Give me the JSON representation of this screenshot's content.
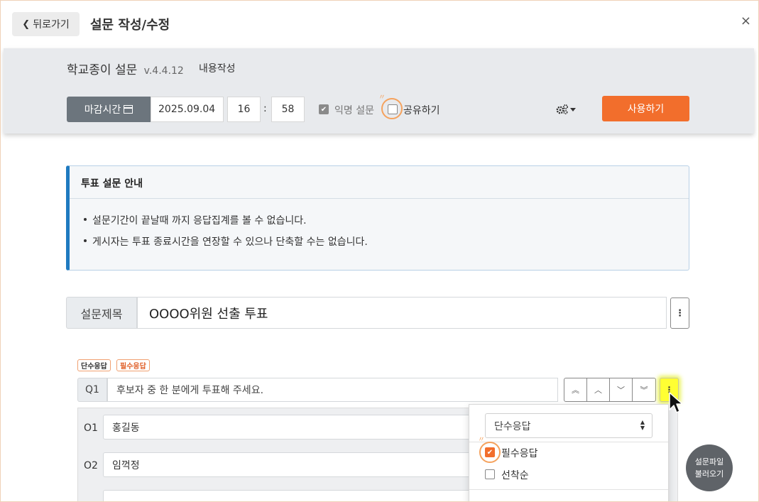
{
  "header": {
    "back_label": "뒤로가기",
    "title": "설문 작성/수정",
    "close_symbol": "×"
  },
  "toolbar": {
    "app_name": "학교종이 설문",
    "version": "v.4.4.12",
    "mode": "내용작성",
    "deadline_label": "마감시간",
    "date": "2025.09.04",
    "hour": "16",
    "minute": "58",
    "anonymous_label": "익명 설문",
    "anonymous_checked": true,
    "share_label": "공유하기",
    "share_checked": false,
    "settings_icon": "gears-icon",
    "use_button": "사용하기"
  },
  "notice": {
    "title": "투표 설문 안내",
    "items": [
      "설문기간이 끝날때 까지 응답집계를 볼 수 없습니다.",
      "게시자는 투표 종료시간을 연장할 수 있으나 단축할 수는 없습니다."
    ]
  },
  "survey": {
    "title_label": "설문제목",
    "title_value": "OOOO위원 선출 투표"
  },
  "question": {
    "badges": [
      "단수응답",
      "필수응답"
    ],
    "label": "Q1",
    "text": "후보자 중 한 분에게 투표해 주세요.",
    "options": [
      {
        "label": "O1",
        "value": "홍길동"
      },
      {
        "label": "O2",
        "value": "임꺽정"
      }
    ]
  },
  "dropdown": {
    "type_selected": "단수응답",
    "required_label": "필수응답",
    "required_checked": true,
    "first_come_label": "선착순",
    "first_come_checked": false
  },
  "floating": {
    "line1": "설문파일",
    "line2": "불러오기"
  },
  "colors": {
    "accent": "#f26e2c",
    "notice_border": "#1f7ac0",
    "highlight": "#ffff33",
    "deadline_bg": "#6c757d"
  }
}
